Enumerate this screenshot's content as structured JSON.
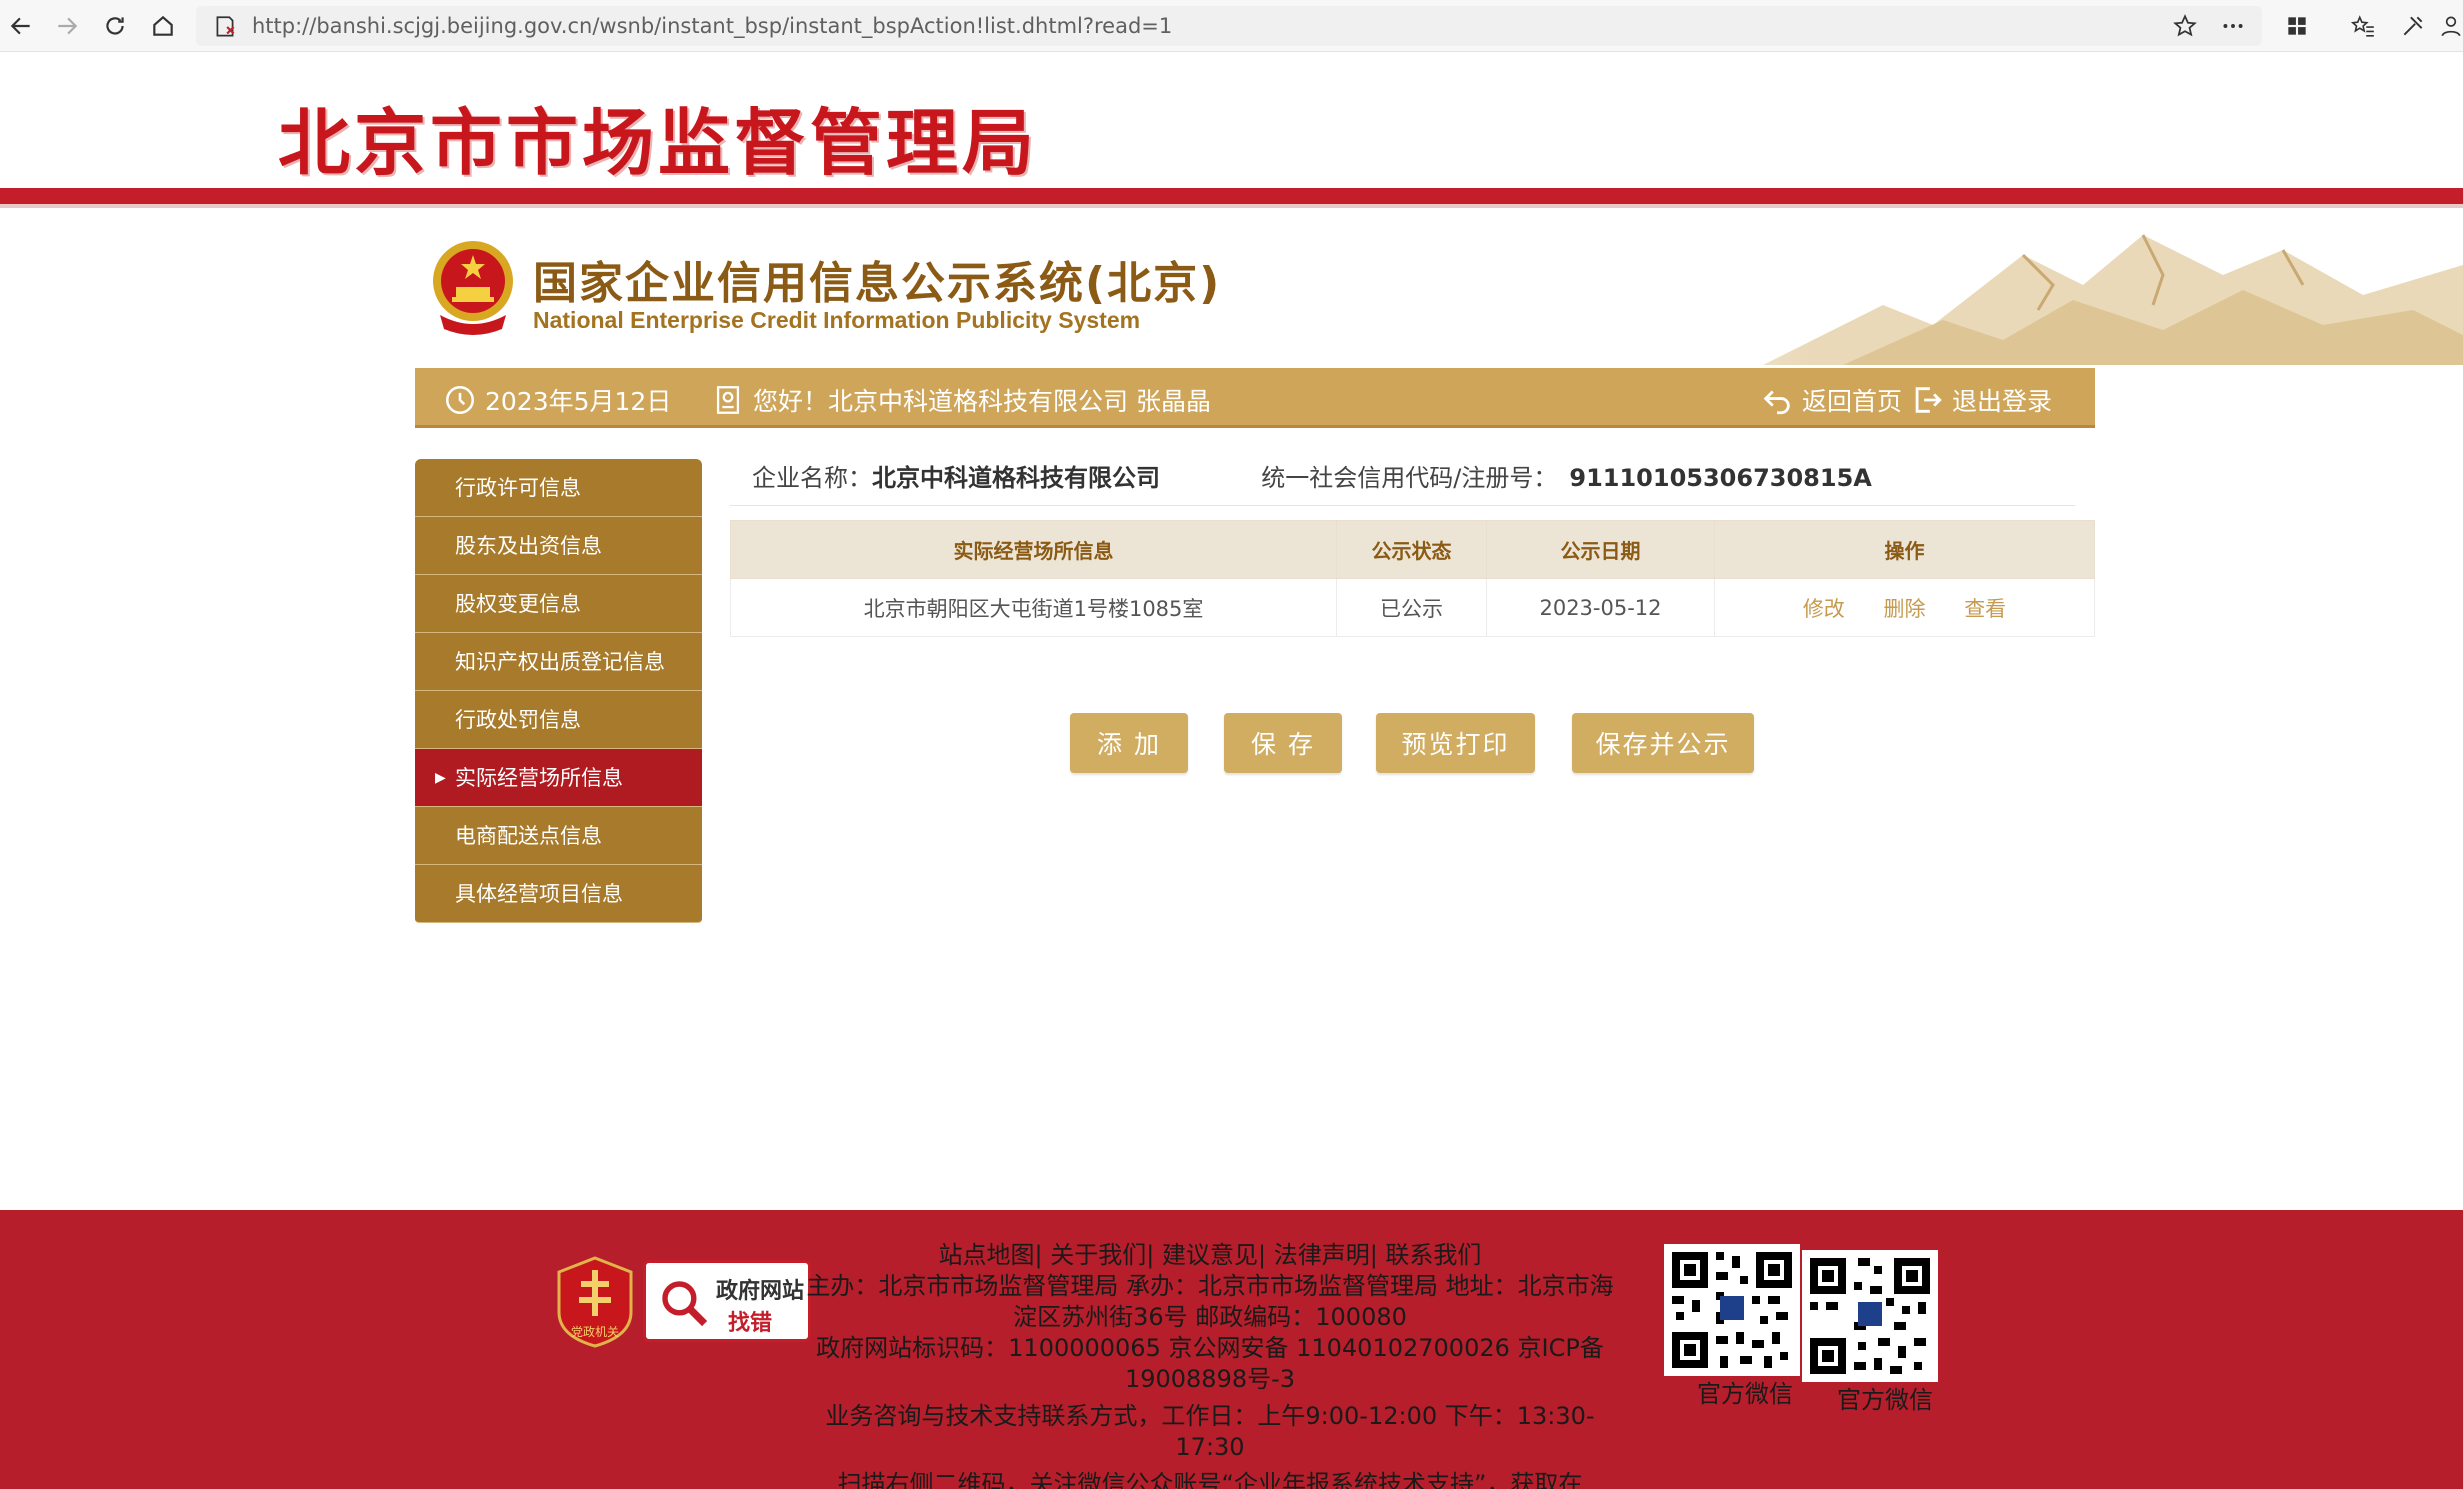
{
  "browser": {
    "url": "http://banshi.scjgj.beijing.gov.cn/wsnb/instant_bsp/instant_bspAction!list.dhtml?read=1"
  },
  "header": {
    "site_title": "北京市市场监督管理局"
  },
  "banner": {
    "title_cn": "国家企业信用信息公示系统(北京)",
    "title_en": "National Enterprise Credit Information Publicity System"
  },
  "info_bar": {
    "date": "2023年5月12日",
    "greeting": "您好！北京中科道格科技有限公司  张晶晶",
    "home_label": "返回首页",
    "logout_label": "退出登录"
  },
  "sidebar": {
    "items": [
      {
        "label": "行政许可信息"
      },
      {
        "label": "股东及出资信息"
      },
      {
        "label": "股权变更信息"
      },
      {
        "label": "知识产权出质登记信息"
      },
      {
        "label": "行政处罚信息"
      },
      {
        "label": "实际经营场所信息"
      },
      {
        "label": "电商配送点信息"
      },
      {
        "label": "具体经营项目信息"
      }
    ],
    "active_index": 5
  },
  "company": {
    "name_label": "企业名称：",
    "name": "北京中科道格科技有限公司",
    "code_label": "统一社会信用代码/注册号：",
    "code": "91110105306730815A"
  },
  "table": {
    "headers": [
      "实际经营场所信息",
      "公示状态",
      "公示日期",
      "操作"
    ],
    "rows": [
      {
        "address": "北京市朝阳区大屯街道1号楼1085室",
        "status": "已公示",
        "date": "2023-05-12"
      }
    ],
    "ops": {
      "edit": "修改",
      "delete": "删除",
      "view": "查看"
    }
  },
  "actions": {
    "add": "添 加",
    "save": "保 存",
    "preview_print": "预览打印",
    "save_publish": "保存并公示"
  },
  "footer": {
    "links": "站点地图| 关于我们| 建议意见| 法律声明| 联系我们",
    "sponsor": "主办：北京市市场监督管理局 承办：北京市市场监督管理局 地址：北京市海淀区苏州街36号 邮政编码：100080",
    "ids": "政府网站标识码：1100000065     京公网安备 11040102700026     京ICP备19008898号-3",
    "support": "业务咨询与技术支持联系方式，工作日：上午9:00-12:00 下午：13:30-17:30",
    "scan": "扫描右侧二维码，关注微信公众账号“企业年报系统技术支持”，获取在",
    "logo2_line1": "政府网站",
    "logo2_line2": "找错",
    "logo1_text": "党政机关",
    "qr1_label": "官方微信",
    "qr2_label": "官方微信"
  },
  "colors": {
    "brand_red": "#c41e2a",
    "gold": "#cfa55a",
    "sidebar_gold": "#a87a2c",
    "active_red": "#b01a21",
    "button_gold": "#d1ad62"
  }
}
